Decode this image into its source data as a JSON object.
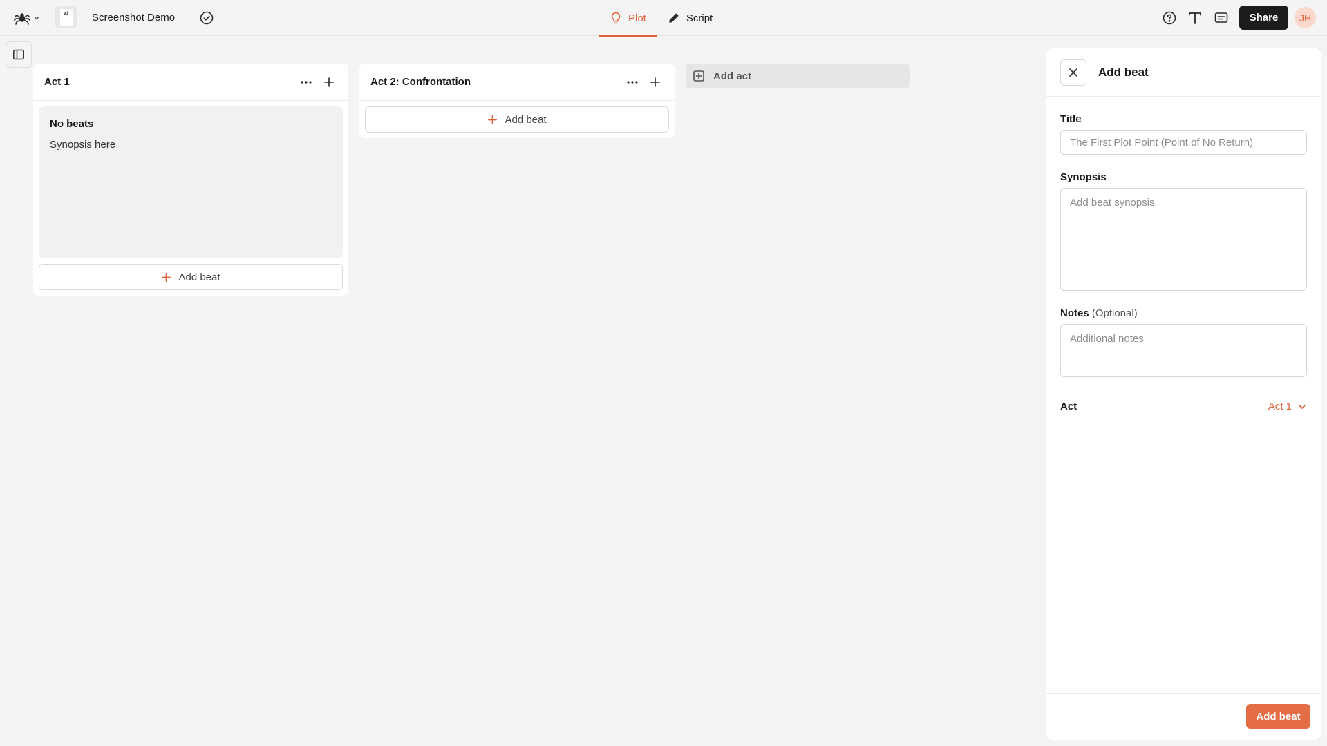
{
  "colors": {
    "accent": "#e0613a",
    "dark": "#1c1c1c",
    "background": "#f4f4f4"
  },
  "topbar": {
    "document_title": "Screenshot Demo",
    "doc_thumb_text": "v1",
    "tabs": [
      {
        "label": "Plot",
        "icon": "bulb-icon",
        "active": true
      },
      {
        "label": "Script",
        "icon": "pencil-icon",
        "active": false
      }
    ],
    "share_label": "Share",
    "avatar_initials": "JH"
  },
  "board": {
    "acts": [
      {
        "title": "Act 1",
        "beats": [
          {
            "title": "No beats",
            "synopsis": "Synopsis here"
          }
        ],
        "add_beat_label": "Add beat"
      },
      {
        "title": "Act 2: Confrontation",
        "beats": [],
        "add_beat_label": "Add beat"
      }
    ],
    "add_act_label": "Add act"
  },
  "panel": {
    "title": "Add beat",
    "title_field": {
      "label": "Title",
      "placeholder": "The First Plot Point (Point of No Return)",
      "value": ""
    },
    "synopsis_field": {
      "label": "Synopsis",
      "placeholder": "Add beat synopsis",
      "value": ""
    },
    "notes_field": {
      "label": "Notes",
      "optional_label": "(Optional)",
      "placeholder": "Additional notes",
      "value": ""
    },
    "act_field": {
      "label": "Act",
      "selected": "Act 1"
    },
    "submit_label": "Add beat"
  }
}
